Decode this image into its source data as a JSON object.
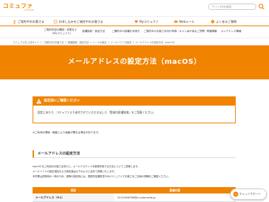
{
  "header": {
    "logo": "コミュファ",
    "logo_sub": "commufa",
    "search_placeholder": "サイト内を検索"
  },
  "nav": {
    "items": [
      "ご契約中のお客さま",
      "お申し込みをご検討中のお客さま",
      "Myコミュファ",
      "Webメール",
      "よくあるご質問"
    ]
  },
  "subnav": {
    "items": [
      "ご契約内容の確認・変更など",
      "各種接続・設定方法",
      "ご解約中の各種お手続き",
      "ご契約中のお客さま向け特典・キャンペーン",
      "よくあるご質問",
      "障害情報",
      "メンテナンス情報"
    ],
    "sub_label": "(Myコミュファ)"
  },
  "breadcrumb": "コミュファ光 公式サイト ＞ ご契約中のお客さま ＞ 各種接続・設定方法 ＞ メールの設定 ＞ メールソフトの設定 ＞ メールアドレスの設定方法（macOS）",
  "hero": {
    "title": "メールアドレスの設定方法（macOS）"
  },
  "notice": {
    "title": "設定前にご確認ください",
    "body": "設定にあたり、コミュファより送付させていただきました「登録内容通知書」をご用意ください。"
  },
  "note": "※ご利用の環境・機能により画面が異なる場合があります。",
  "section": {
    "title": "メールアドレスの設定方法",
    "paragraphs": [
      "macOS をご利用のお客さま向けに、メールアカウントを新規作成する方法についてご説明します。",
      "メールソフトの設定項目および設定値は以下のように定めて説明いたします。",
      "本作業は説明用の一例のため、実際の設定時には、登録内容通知書やMyコミュファでお客さまご自身の情報をご確認ください。"
    ]
  },
  "table": {
    "headers": [
      "項目",
      "登録内容"
    ],
    "rows": [
      {
        "label": "メールアドレス（※1）",
        "value": "0123456789@c.commufa.jp"
      }
    ]
  },
  "chat": {
    "label": "チャットサポート"
  },
  "colors": {
    "brand": "#f08300"
  }
}
